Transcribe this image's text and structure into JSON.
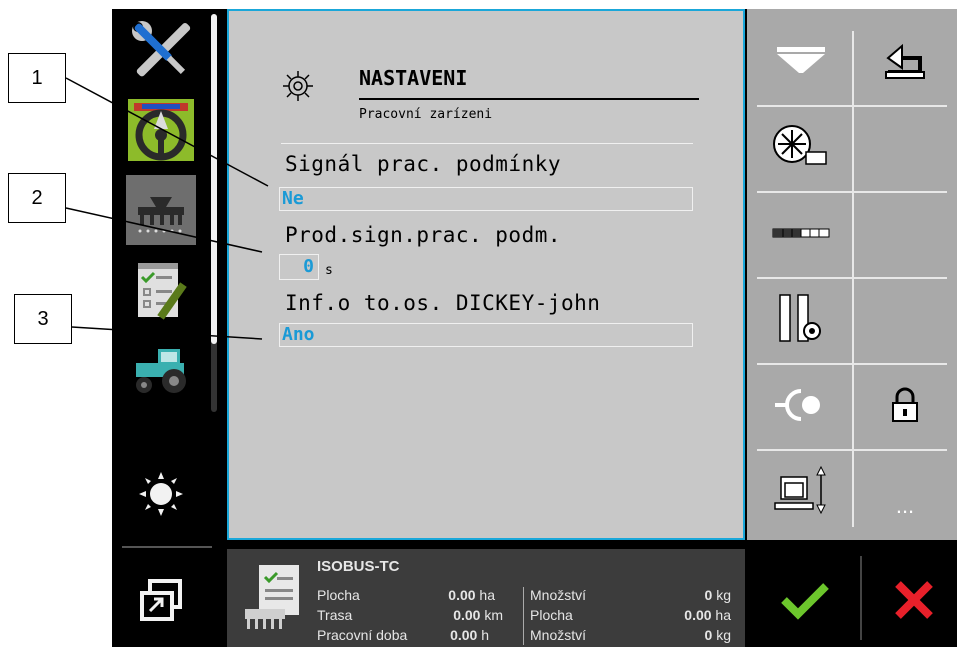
{
  "callouts": [
    "1",
    "2",
    "3"
  ],
  "screen": {
    "title": "NASTAVENI",
    "subtitle": "Pracovní zarízeni",
    "settings": [
      {
        "label": "Signál prac. podmínky",
        "value": "Ne"
      },
      {
        "label": "Prod.sign.prac. podm.",
        "value": "0",
        "unit": "s"
      },
      {
        "label": "Inf.o to.os. DICKEY-john",
        "value": "Ano"
      }
    ]
  },
  "sidebar": {
    "items": [
      "wrench-screwdriver-icon",
      "steering-wheel-icon",
      "seeder-icon",
      "checklist-icon",
      "tractor-icon",
      "brightness-icon",
      "window-switch-icon"
    ]
  },
  "right_panel": {
    "more_label": "...",
    "buttons": [
      "hopper-icon",
      "back-icon",
      "fan-icon",
      "section-bar-icon",
      "tramline-settings-icon",
      "hitch-icon",
      "lock-icon",
      "lift-icon",
      "more-icon"
    ]
  },
  "bottom": {
    "app_name": "ISOBUS-TC",
    "rows": [
      {
        "label1": "Plocha",
        "value1": "0.00",
        "unit1": "ha",
        "label2": "Množství",
        "value2": "0",
        "unit2": "kg"
      },
      {
        "label1": "Trasa",
        "value1": "0.00",
        "unit1": "km",
        "label2": "Plocha",
        "value2": "0.00",
        "unit2": "ha"
      },
      {
        "label1": "Pracovní doba",
        "value1": "0.00",
        "unit1": "h",
        "label2": "Množství",
        "value2": "0",
        "unit2": "kg"
      }
    ]
  },
  "colors": {
    "accent": "#1aa7d9",
    "confirm": "#6cc62c",
    "cancel": "#e8202a"
  }
}
